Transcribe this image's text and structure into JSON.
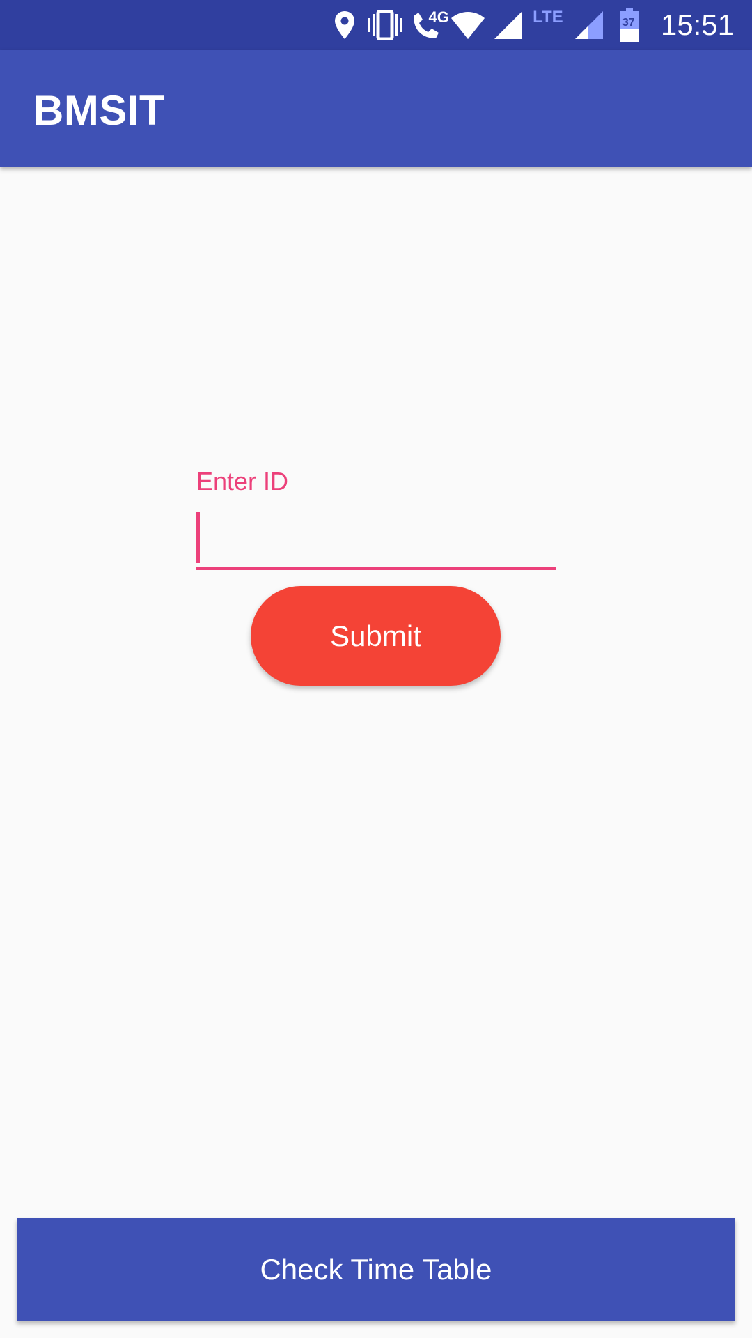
{
  "status_bar": {
    "time": "15:51",
    "network_label": "4G",
    "lte_label": "LTE",
    "battery_level": "37",
    "icons": [
      "location-icon",
      "vibrate-icon",
      "wifi-call-icon",
      "wifi-icon",
      "signal-icon",
      "signal-weak-icon",
      "battery-icon"
    ]
  },
  "toolbar": {
    "title": "BMSIT"
  },
  "form": {
    "id_label": "Enter ID",
    "id_value": "",
    "submit_label": "Submit"
  },
  "bottom": {
    "timetable_label": "Check Time Table"
  },
  "colors": {
    "status_bar": "#303f9f",
    "primary": "#3f51b5",
    "accent": "#ec407a",
    "submit": "#f44336",
    "background": "#fafafa"
  }
}
